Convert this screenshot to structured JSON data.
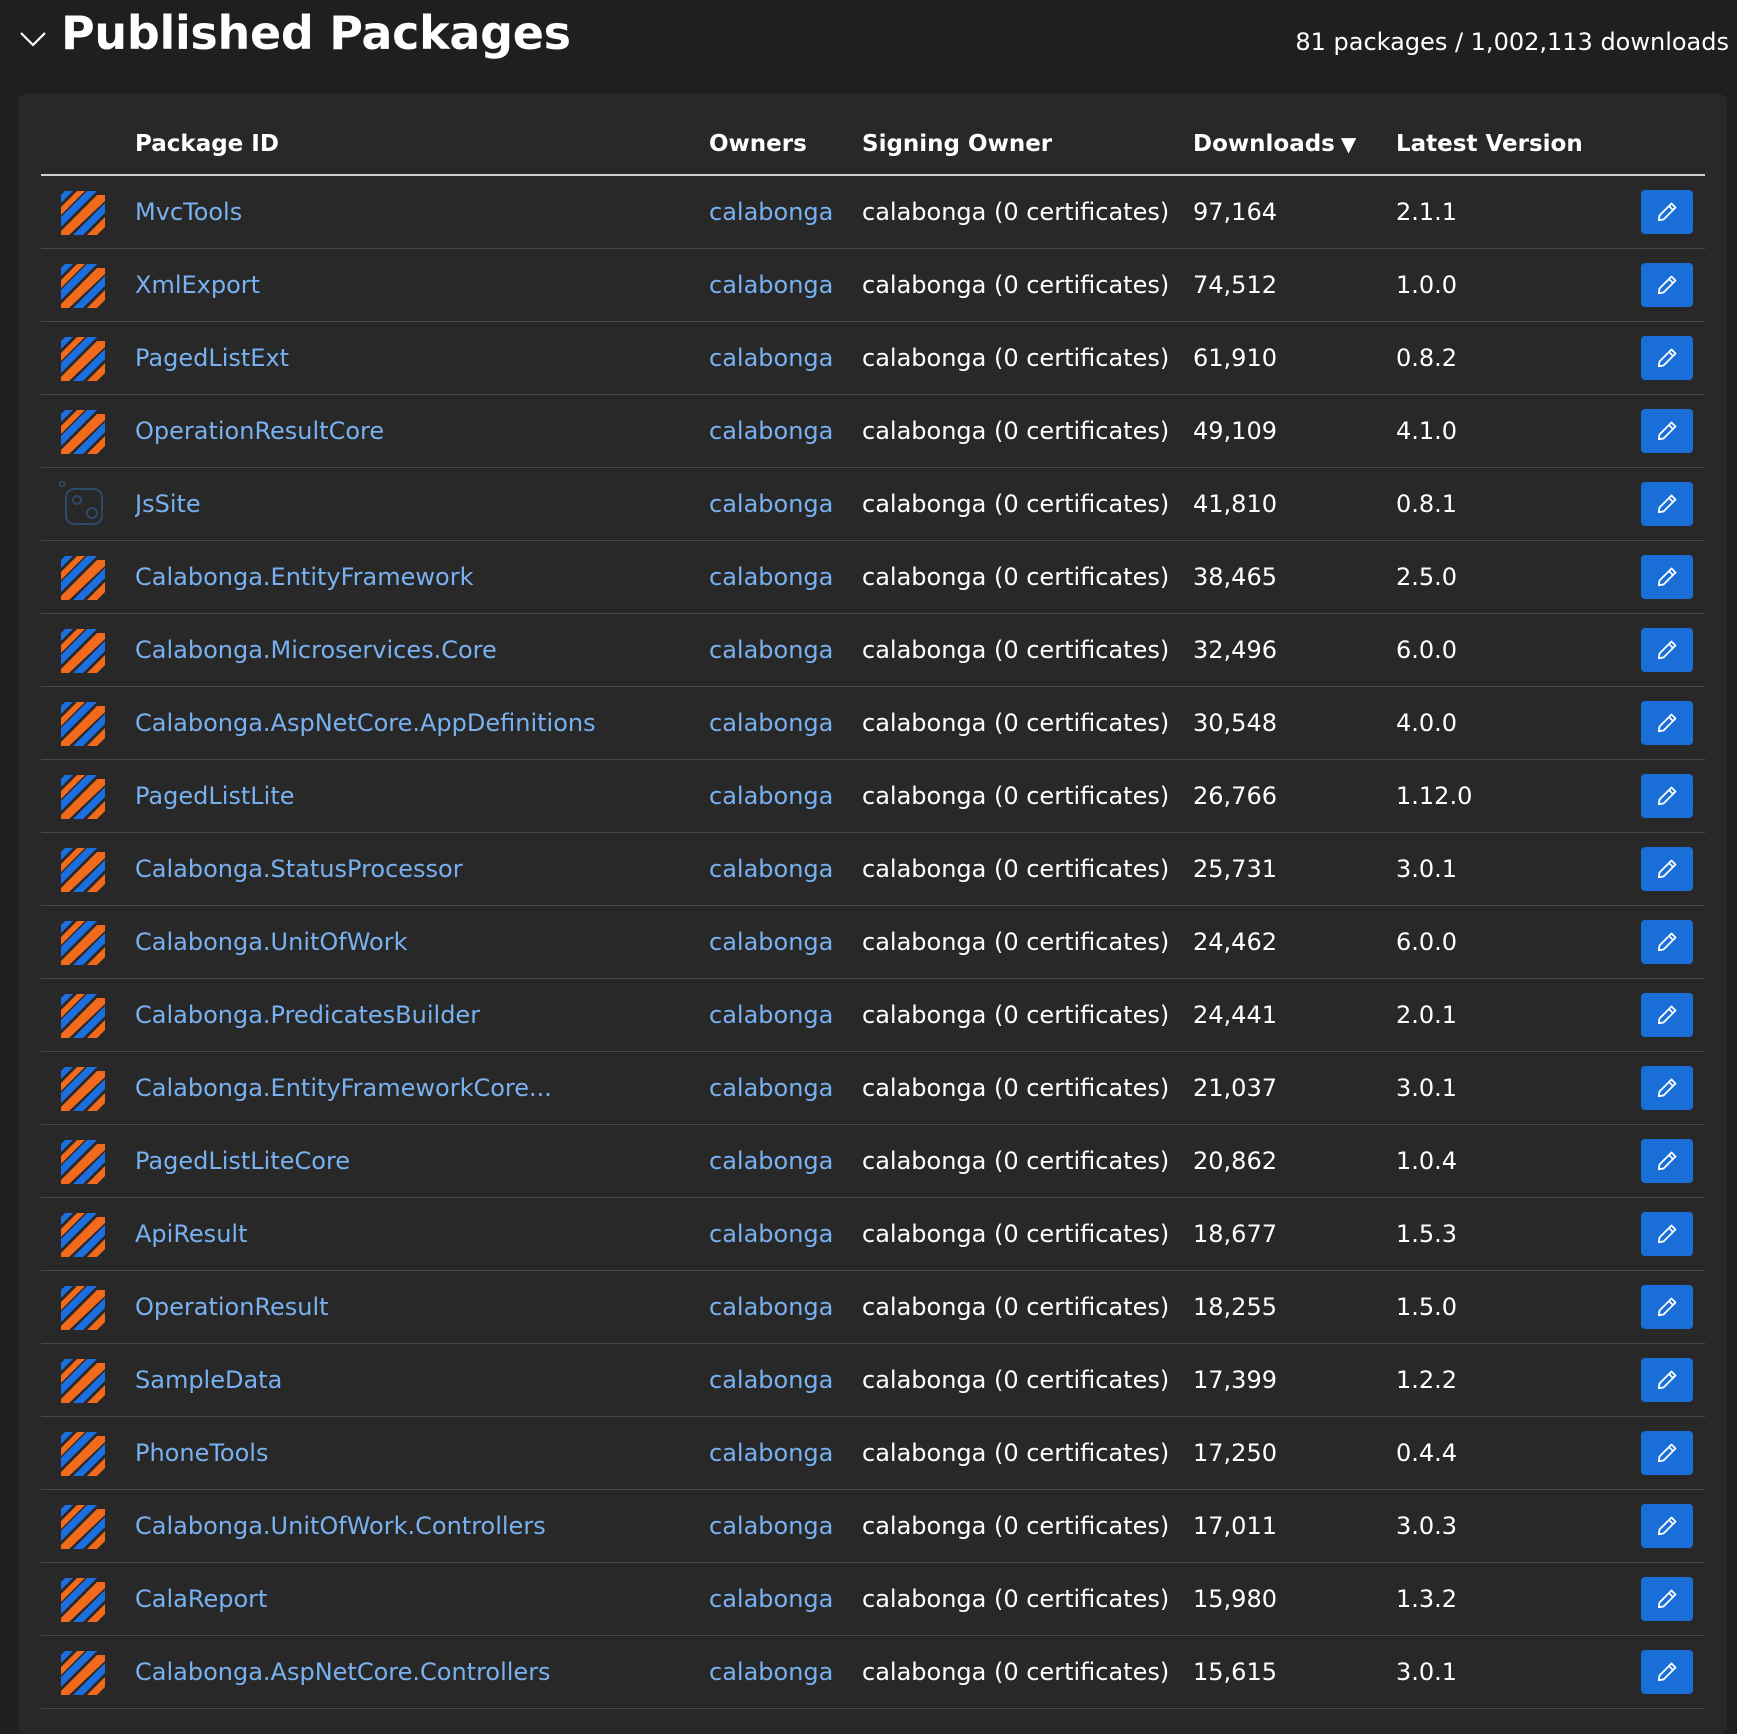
{
  "header": {
    "title": "Published Packages",
    "summary": "81 packages / 1,002,113 downloads"
  },
  "columns": {
    "package_id": "Package ID",
    "owners": "Owners",
    "signing_owner": "Signing Owner",
    "downloads": "Downloads",
    "downloads_sort_icon": "▼",
    "latest_version": "Latest Version"
  },
  "icons": {
    "collapse": "chevron-down-icon",
    "package_default": "striped-package-icon",
    "package_jssite": "generic-package-icon",
    "edit": "pencil-icon"
  },
  "colors": {
    "link": "#79b1f0",
    "edit_button": "#1a6ed8",
    "icon_orange": "#f26b1d",
    "icon_blue": "#1d6fe0"
  },
  "rows": [
    {
      "id": "MvcTools",
      "owner": "calabonga",
      "signing": "calabonga (0 certificates)",
      "downloads": "97,164",
      "version": "2.1.1",
      "icon": "striped"
    },
    {
      "id": "XmlExport",
      "owner": "calabonga",
      "signing": "calabonga (0 certificates)",
      "downloads": "74,512",
      "version": "1.0.0",
      "icon": "striped"
    },
    {
      "id": "PagedListExt",
      "owner": "calabonga",
      "signing": "calabonga (0 certificates)",
      "downloads": "61,910",
      "version": "0.8.2",
      "icon": "striped"
    },
    {
      "id": "OperationResultCore",
      "owner": "calabonga",
      "signing": "calabonga (0 certificates)",
      "downloads": "49,109",
      "version": "4.1.0",
      "icon": "striped"
    },
    {
      "id": "JsSite",
      "owner": "calabonga",
      "signing": "calabonga (0 certificates)",
      "downloads": "41,810",
      "version": "0.8.1",
      "icon": "generic"
    },
    {
      "id": "Calabonga.EntityFramework",
      "owner": "calabonga",
      "signing": "calabonga (0 certificates)",
      "downloads": "38,465",
      "version": "2.5.0",
      "icon": "striped"
    },
    {
      "id": "Calabonga.Microservices.Core",
      "owner": "calabonga",
      "signing": "calabonga (0 certificates)",
      "downloads": "32,496",
      "version": "6.0.0",
      "icon": "striped"
    },
    {
      "id": "Calabonga.AspNetCore.AppDefinitions",
      "owner": "calabonga",
      "signing": "calabonga (0 certificates)",
      "downloads": "30,548",
      "version": "4.0.0",
      "icon": "striped"
    },
    {
      "id": "PagedListLite",
      "owner": "calabonga",
      "signing": "calabonga (0 certificates)",
      "downloads": "26,766",
      "version": "1.12.0",
      "icon": "striped"
    },
    {
      "id": "Calabonga.StatusProcessor",
      "owner": "calabonga",
      "signing": "calabonga (0 certificates)",
      "downloads": "25,731",
      "version": "3.0.1",
      "icon": "striped"
    },
    {
      "id": "Calabonga.UnitOfWork",
      "owner": "calabonga",
      "signing": "calabonga (0 certificates)",
      "downloads": "24,462",
      "version": "6.0.0",
      "icon": "striped"
    },
    {
      "id": "Calabonga.PredicatesBuilder",
      "owner": "calabonga",
      "signing": "calabonga (0 certificates)",
      "downloads": "24,441",
      "version": "2.0.1",
      "icon": "striped"
    },
    {
      "id": "Calabonga.EntityFrameworkCore...",
      "owner": "calabonga",
      "signing": "calabonga (0 certificates)",
      "downloads": "21,037",
      "version": "3.0.1",
      "icon": "striped"
    },
    {
      "id": "PagedListLiteCore",
      "owner": "calabonga",
      "signing": "calabonga (0 certificates)",
      "downloads": "20,862",
      "version": "1.0.4",
      "icon": "striped"
    },
    {
      "id": "ApiResult",
      "owner": "calabonga",
      "signing": "calabonga (0 certificates)",
      "downloads": "18,677",
      "version": "1.5.3",
      "icon": "striped"
    },
    {
      "id": "OperationResult",
      "owner": "calabonga",
      "signing": "calabonga (0 certificates)",
      "downloads": "18,255",
      "version": "1.5.0",
      "icon": "striped"
    },
    {
      "id": "SampleData",
      "owner": "calabonga",
      "signing": "calabonga (0 certificates)",
      "downloads": "17,399",
      "version": "1.2.2",
      "icon": "striped"
    },
    {
      "id": "PhoneTools",
      "owner": "calabonga",
      "signing": "calabonga (0 certificates)",
      "downloads": "17,250",
      "version": "0.4.4",
      "icon": "striped"
    },
    {
      "id": "Calabonga.UnitOfWork.Controllers",
      "owner": "calabonga",
      "signing": "calabonga (0 certificates)",
      "downloads": "17,011",
      "version": "3.0.3",
      "icon": "striped"
    },
    {
      "id": "CalaReport",
      "owner": "calabonga",
      "signing": "calabonga (0 certificates)",
      "downloads": "15,980",
      "version": "1.3.2",
      "icon": "striped"
    },
    {
      "id": "Calabonga.AspNetCore.Controllers",
      "owner": "calabonga",
      "signing": "calabonga (0 certificates)",
      "downloads": "15,615",
      "version": "3.0.1",
      "icon": "striped"
    }
  ]
}
